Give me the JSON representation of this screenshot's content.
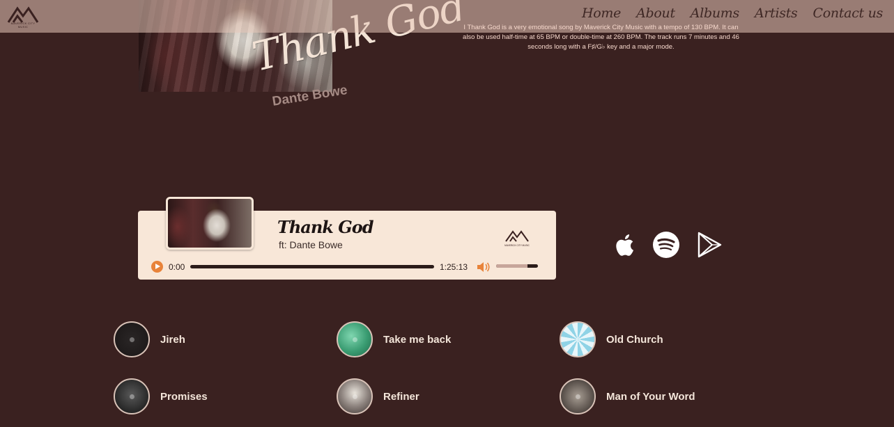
{
  "brand": {
    "logo_text": "MAVERICK CITY MUSIC"
  },
  "nav": {
    "items": [
      "Home",
      "About",
      "Albums",
      "Artists",
      "Contact us"
    ]
  },
  "hero": {
    "song_title": "Thank God",
    "artist": "Dante Bowe",
    "description": "I Thank God is a very emotional song by Maverick City Music with a tempo of 130 BPM. It can also be used half-time at 65 BPM or double-time at 260 BPM. The track runs 7 minutes and 46 seconds long with a F♯/G♭ key and a major mode."
  },
  "player": {
    "title": "Thank God",
    "subtitle": "ft: Dante Bowe",
    "current_time": "0:00",
    "total_time": "1:25:13",
    "progress": 0,
    "volume": 0.75,
    "logo_text": "MAVERICK CITY MUSIC",
    "colors": {
      "accent": "#e8833a",
      "card": "#f8e7d8"
    }
  },
  "stores": [
    {
      "name": "Apple Music",
      "icon": "apple-icon"
    },
    {
      "name": "Spotify",
      "icon": "spotify-icon"
    },
    {
      "name": "Google Play",
      "icon": "google-play-icon"
    }
  ],
  "songs": [
    {
      "title": "Jireh"
    },
    {
      "title": "Take me back"
    },
    {
      "title": "Old Church"
    },
    {
      "title": "Promises"
    },
    {
      "title": "Refiner"
    },
    {
      "title": "Man of Your Word"
    }
  ],
  "colors": {
    "background": "#3a2120",
    "text": "#f4e6da",
    "topbar": "#e7c8b9"
  }
}
